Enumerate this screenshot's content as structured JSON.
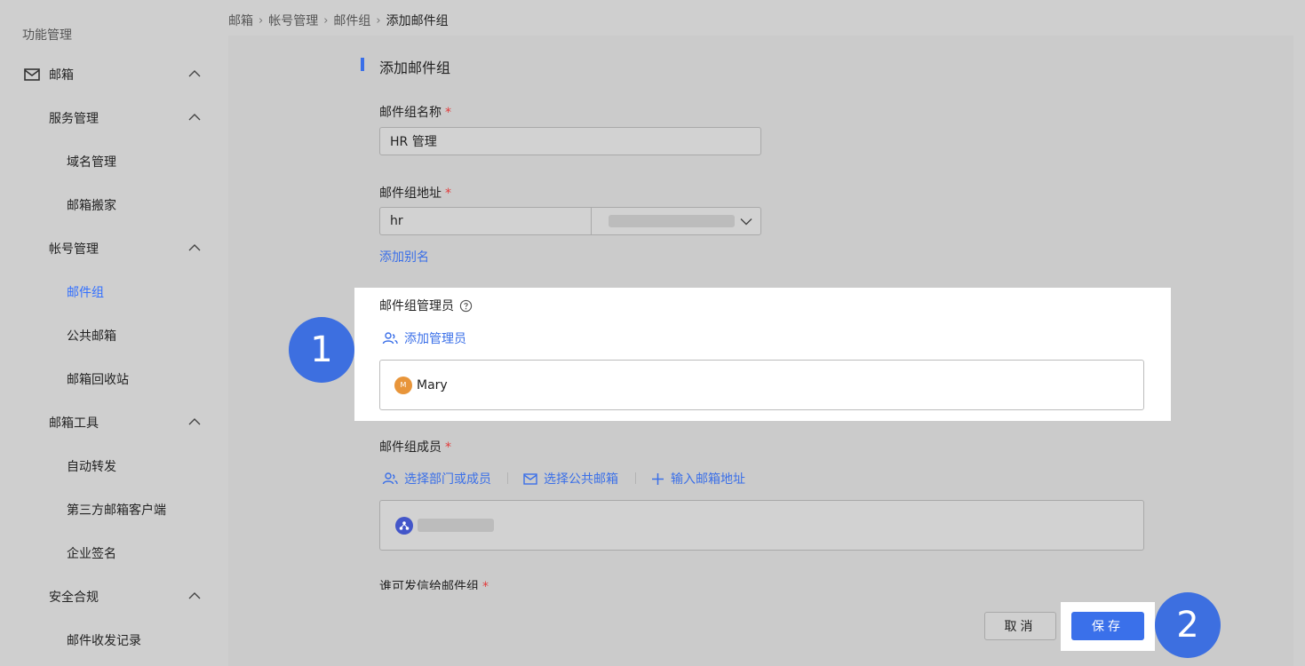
{
  "sidebar": {
    "title": "功能管理",
    "mailbox": "邮箱",
    "service_mgmt": "服务管理",
    "domain_mgmt": "域名管理",
    "mailbox_move": "邮箱搬家",
    "account_mgmt": "帐号管理",
    "mail_group": "邮件组",
    "public_mailbox": "公共邮箱",
    "mailbox_recycle": "邮箱回收站",
    "mailbox_tools": "邮箱工具",
    "auto_forward": "自动转发",
    "third_party_client": "第三方邮箱客户端",
    "enterprise_signature": "企业签名",
    "security_compliance": "安全合规",
    "mail_logs": "邮件收发记录"
  },
  "breadcrumb": [
    "邮箱",
    "帐号管理",
    "邮件组",
    "添加邮件组"
  ],
  "form": {
    "section_title": "添加邮件组",
    "name_label": "邮件组名称",
    "name_value": "HR 管理",
    "address_label": "邮件组地址",
    "address_value": "hr",
    "add_alias": "添加别名",
    "admin_label": "邮件组管理员",
    "add_admin": "添加管理员",
    "admin_initial": "M",
    "admin_name": "Mary",
    "members_label": "邮件组成员",
    "select_dept": "选择部门或成员",
    "select_public": "选择公共邮箱",
    "enter_address": "输入邮箱地址",
    "cut_label": "谁可发信给邮件组",
    "required_mark": "*"
  },
  "buttons": {
    "cancel": "取消",
    "save": "保存"
  },
  "badges": {
    "one": "1",
    "two": "2"
  },
  "colors": {
    "accent": "#3a6fe8",
    "badge": "#3d6fe0",
    "required": "#e23b3b",
    "admin_avatar": "#e8953a"
  }
}
